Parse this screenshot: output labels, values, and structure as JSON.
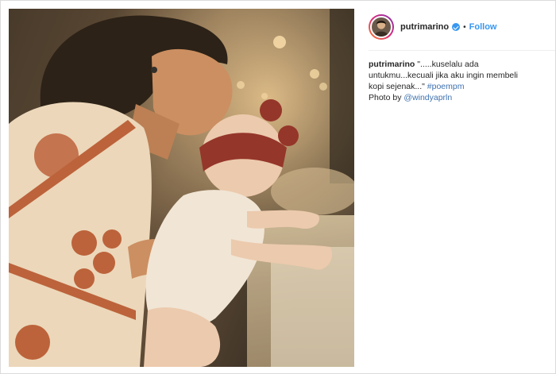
{
  "post": {
    "username": "putrimarino",
    "follow_label": "Follow",
    "separator": "•",
    "caption": {
      "username": "putrimarino",
      "text": "\".....kuselalu ada untukmu...kecuali jika aku ingin membeli kopi sejenak...\"",
      "hashtag": "#poempm",
      "credit_prefix": "Photo by",
      "credit_handle": "@windyaprln"
    }
  },
  "colors": {
    "link": "#3897f0",
    "text": "#262626",
    "hashtag": "#3f72af"
  },
  "icons": [
    "verified-badge-icon"
  ]
}
